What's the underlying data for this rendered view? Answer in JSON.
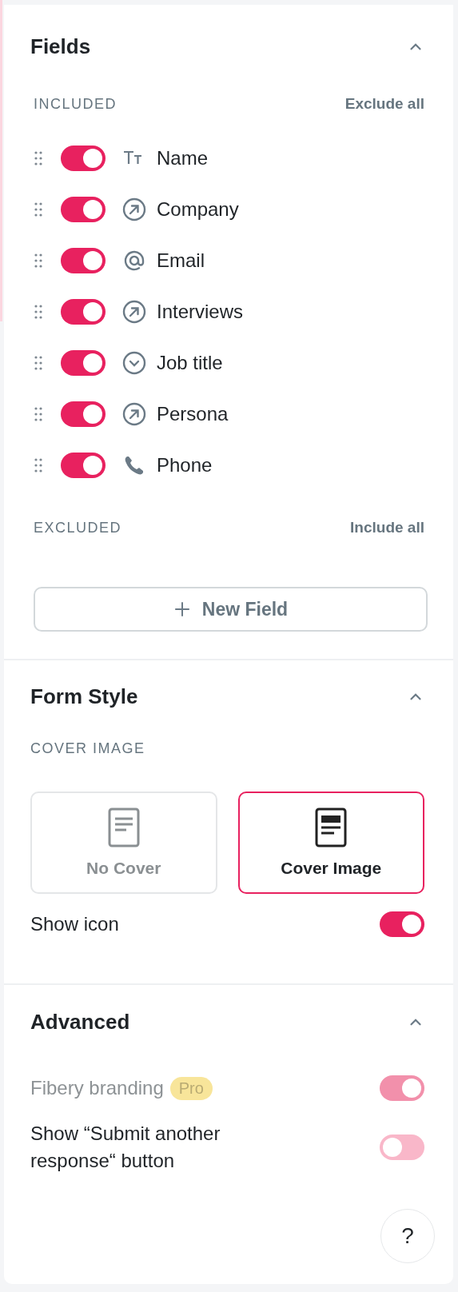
{
  "fields_section": {
    "title": "Fields",
    "expanded": true,
    "included": {
      "label": "INCLUDED",
      "action": "Exclude all",
      "fields": [
        {
          "name": "Name",
          "kind": "text",
          "on": true
        },
        {
          "name": "Company",
          "kind": "relation",
          "on": true
        },
        {
          "name": "Email",
          "kind": "email",
          "on": true
        },
        {
          "name": "Interviews",
          "kind": "relation",
          "on": true
        },
        {
          "name": "Job title",
          "kind": "select",
          "on": true
        },
        {
          "name": "Persona",
          "kind": "relation",
          "on": true
        },
        {
          "name": "Phone",
          "kind": "phone",
          "on": true
        }
      ]
    },
    "excluded": {
      "label": "EXCLUDED",
      "action": "Include all"
    },
    "new_field_button": "New Field"
  },
  "form_style": {
    "title": "Form Style",
    "expanded": true,
    "cover_label": "COVER IMAGE",
    "cover_options": [
      {
        "label": "No Cover",
        "kind": "plain",
        "selected": false
      },
      {
        "label": "Cover Image",
        "kind": "cover",
        "selected": true
      }
    ],
    "show_icon": {
      "label": "Show icon",
      "on": true
    }
  },
  "advanced": {
    "title": "Advanced",
    "expanded": true,
    "settings": [
      {
        "label": "Fibery branding",
        "badge": "Pro",
        "on": true,
        "disabled": true
      },
      {
        "label": "Show “Submit another response“ button",
        "on": false,
        "disabled": false
      }
    ]
  },
  "help_button": "?"
}
